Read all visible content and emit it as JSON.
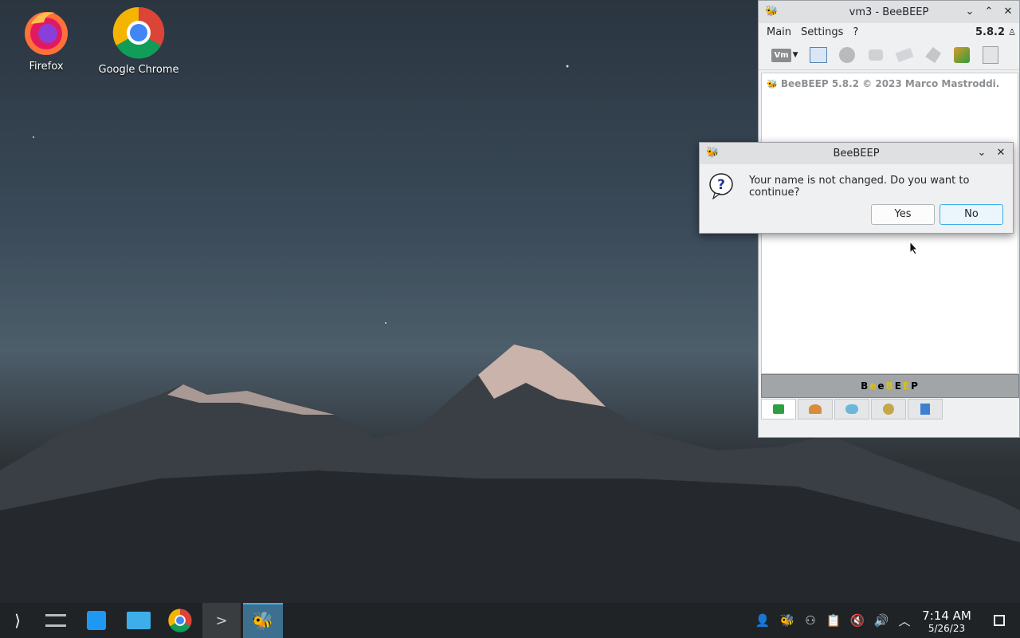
{
  "desktop": {
    "icons": [
      {
        "label": "Firefox"
      },
      {
        "label": "Google Chrome"
      }
    ]
  },
  "main_window": {
    "title": "vm3 - BeeBEEP",
    "menu": [
      "Main",
      "Settings",
      "?"
    ],
    "version": "5.8.2",
    "toolbar_vm_label": "Vm",
    "chat_line": "BeeBEEP 5.8.2 © 2023 Marco Mastroddi.",
    "brand_letters": [
      "B",
      "e",
      "e",
      "B",
      "E",
      "E",
      "P"
    ],
    "brand_colors": [
      "#000000",
      "#d4c020",
      "#000000",
      "#d4c020",
      "#000000",
      "#d4c020",
      "#000000"
    ]
  },
  "dialog": {
    "title": "BeeBEEP",
    "message": "Your name is not changed. Do you want to continue?",
    "yes_label": "Yes",
    "no_label": "No"
  },
  "taskbar": {
    "time": "7:14 AM",
    "date": "5/26/23"
  },
  "colors": {
    "accent": "#3daee9",
    "taskbar_bg": "#202326"
  }
}
